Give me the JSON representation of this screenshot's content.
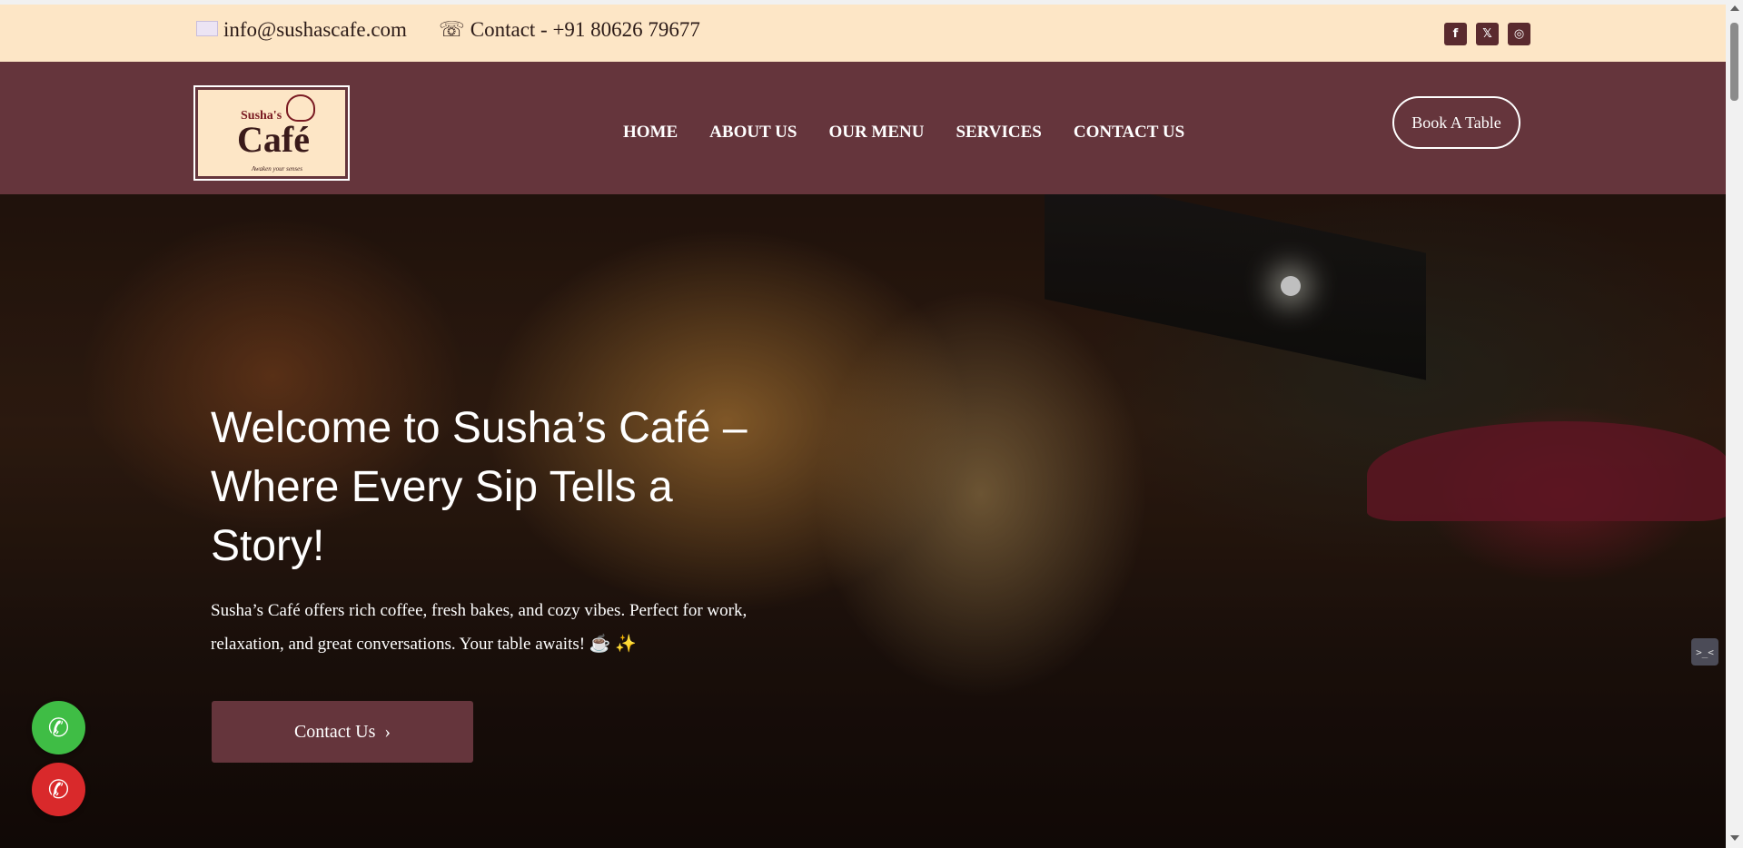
{
  "topbar": {
    "email": "info@sushascafe.com",
    "phone": "Contact - +91 80626 79677",
    "email_icon": "envelope-icon",
    "phone_icon": "telephone-icon",
    "social": [
      {
        "name": "facebook-icon",
        "glyph": "f"
      },
      {
        "name": "x-icon",
        "glyph": "𝕏"
      },
      {
        "name": "instagram-icon",
        "glyph": "◎"
      }
    ]
  },
  "logo": {
    "top": "Susha's",
    "main": "Café",
    "tagline": "Awaken your senses"
  },
  "nav": {
    "items": [
      "HOME",
      "ABOUT US",
      "OUR MENU",
      "SERVICES",
      "CONTACT US"
    ],
    "cta": "Book A Table"
  },
  "hero": {
    "title": "Welcome to Susha’s Café – Where Every Sip Tells a Story!",
    "description": "Susha’s Café offers rich coffee, fresh bakes, and cozy vibes. Perfect for work, relaxation, and great conversations. Your table awaits! ☕ ✨",
    "button": "Contact Us",
    "button_icon": "›"
  },
  "floating": {
    "whatsapp_icon": "whatsapp-icon",
    "call_icon": "phone-icon",
    "whatsapp_glyph": "✆",
    "call_glyph": "✆"
  },
  "colors": {
    "topbar_bg": "#fde6c6",
    "nav_bg": "#65353c",
    "whatsapp": "#3fbd45",
    "call": "#d9292b"
  }
}
